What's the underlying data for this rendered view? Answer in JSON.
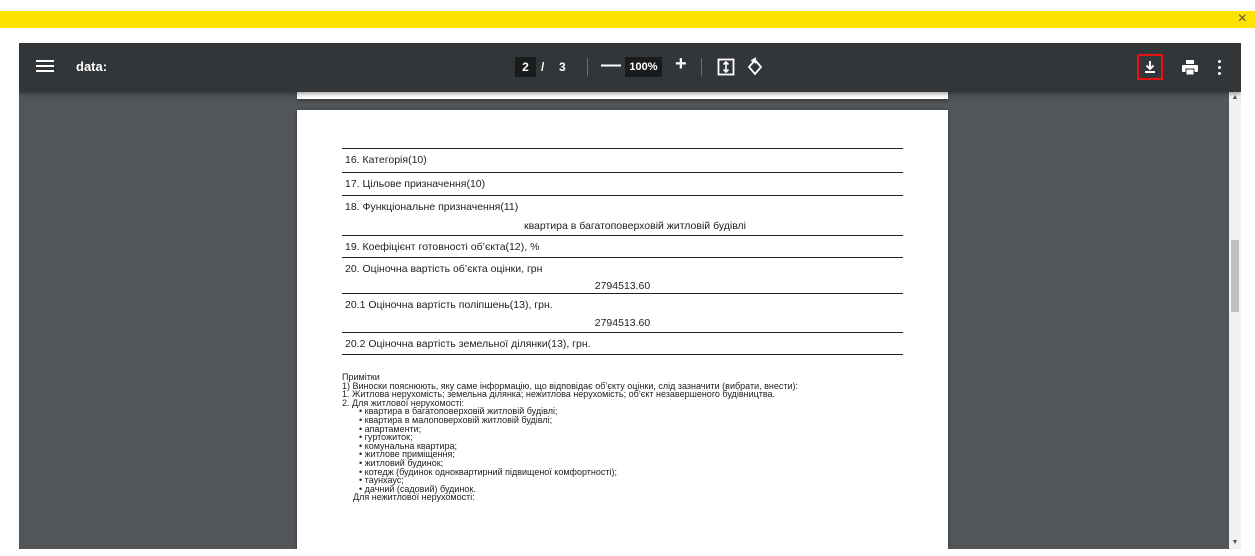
{
  "banner": {
    "close_glyph": "×",
    "color": "#fde301"
  },
  "toolbar": {
    "title": "data:",
    "current_page": "2",
    "page_separator": "/",
    "total_pages": "3",
    "zoom_minus": "—",
    "zoom_level": "100%",
    "zoom_plus": "+",
    "icons": [
      "menu-icon",
      "fit-page-icon",
      "rotate-icon",
      "download-icon",
      "print-icon",
      "more-vert-icon"
    ],
    "highlight_color": "#e81010"
  },
  "document": {
    "rows": [
      {
        "label": "16. Категорія(10)",
        "value": ""
      },
      {
        "label": "17. Цільове призначення(10)",
        "value": ""
      },
      {
        "label": "18. Функціональне призначення(11)",
        "value": "квартира в багатоповерховій житловій будівлі"
      },
      {
        "label": "19. Коефіцієнт готовності об’єкта(12), %",
        "value": ""
      },
      {
        "label": "20. Оціночна вартість об’єкта оцінки, грн",
        "value": "2794513.60"
      },
      {
        "label": "20.1 Оціночна вартість поліпшень(13), грн.",
        "value": "2794513.60"
      },
      {
        "label": "20.2 Оціночна вартість земельної ділянки(13), грн.",
        "value": ""
      }
    ],
    "notes": {
      "heading": "Примітки",
      "lines": [
        "1) Виноски пояснюють, яку саме інформацію, що відповідає об’єкту оцінки, слід зазначити (вибрати, внести):",
        "1.   Житлова нерухомість; земельна ділянка; нежитлова нерухомість; об’єкт незавершеного будівництва.",
        "2.   Для житлової нерухомості:"
      ],
      "bullets": [
        "•  квартира в багатоповерховій житловій будівлі;",
        "•  квартира в малоповерховій житловій будівлі;",
        "•  апартаменти;",
        "•  гуртожиток;",
        "•  комунальна квартира;",
        "•  житлове приміщення;",
        "•  житловий будинок;",
        "•  котедж (будинок одноквартирний підвищеної комфортності);",
        "•  таунхаус;",
        "•  дачний (садовий) будинок."
      ],
      "tail": "Для нежитлової нерухомості:"
    }
  },
  "scrollbar": {
    "up_glyph": "▲",
    "down_glyph": "▼",
    "position_fraction": 0.3
  }
}
